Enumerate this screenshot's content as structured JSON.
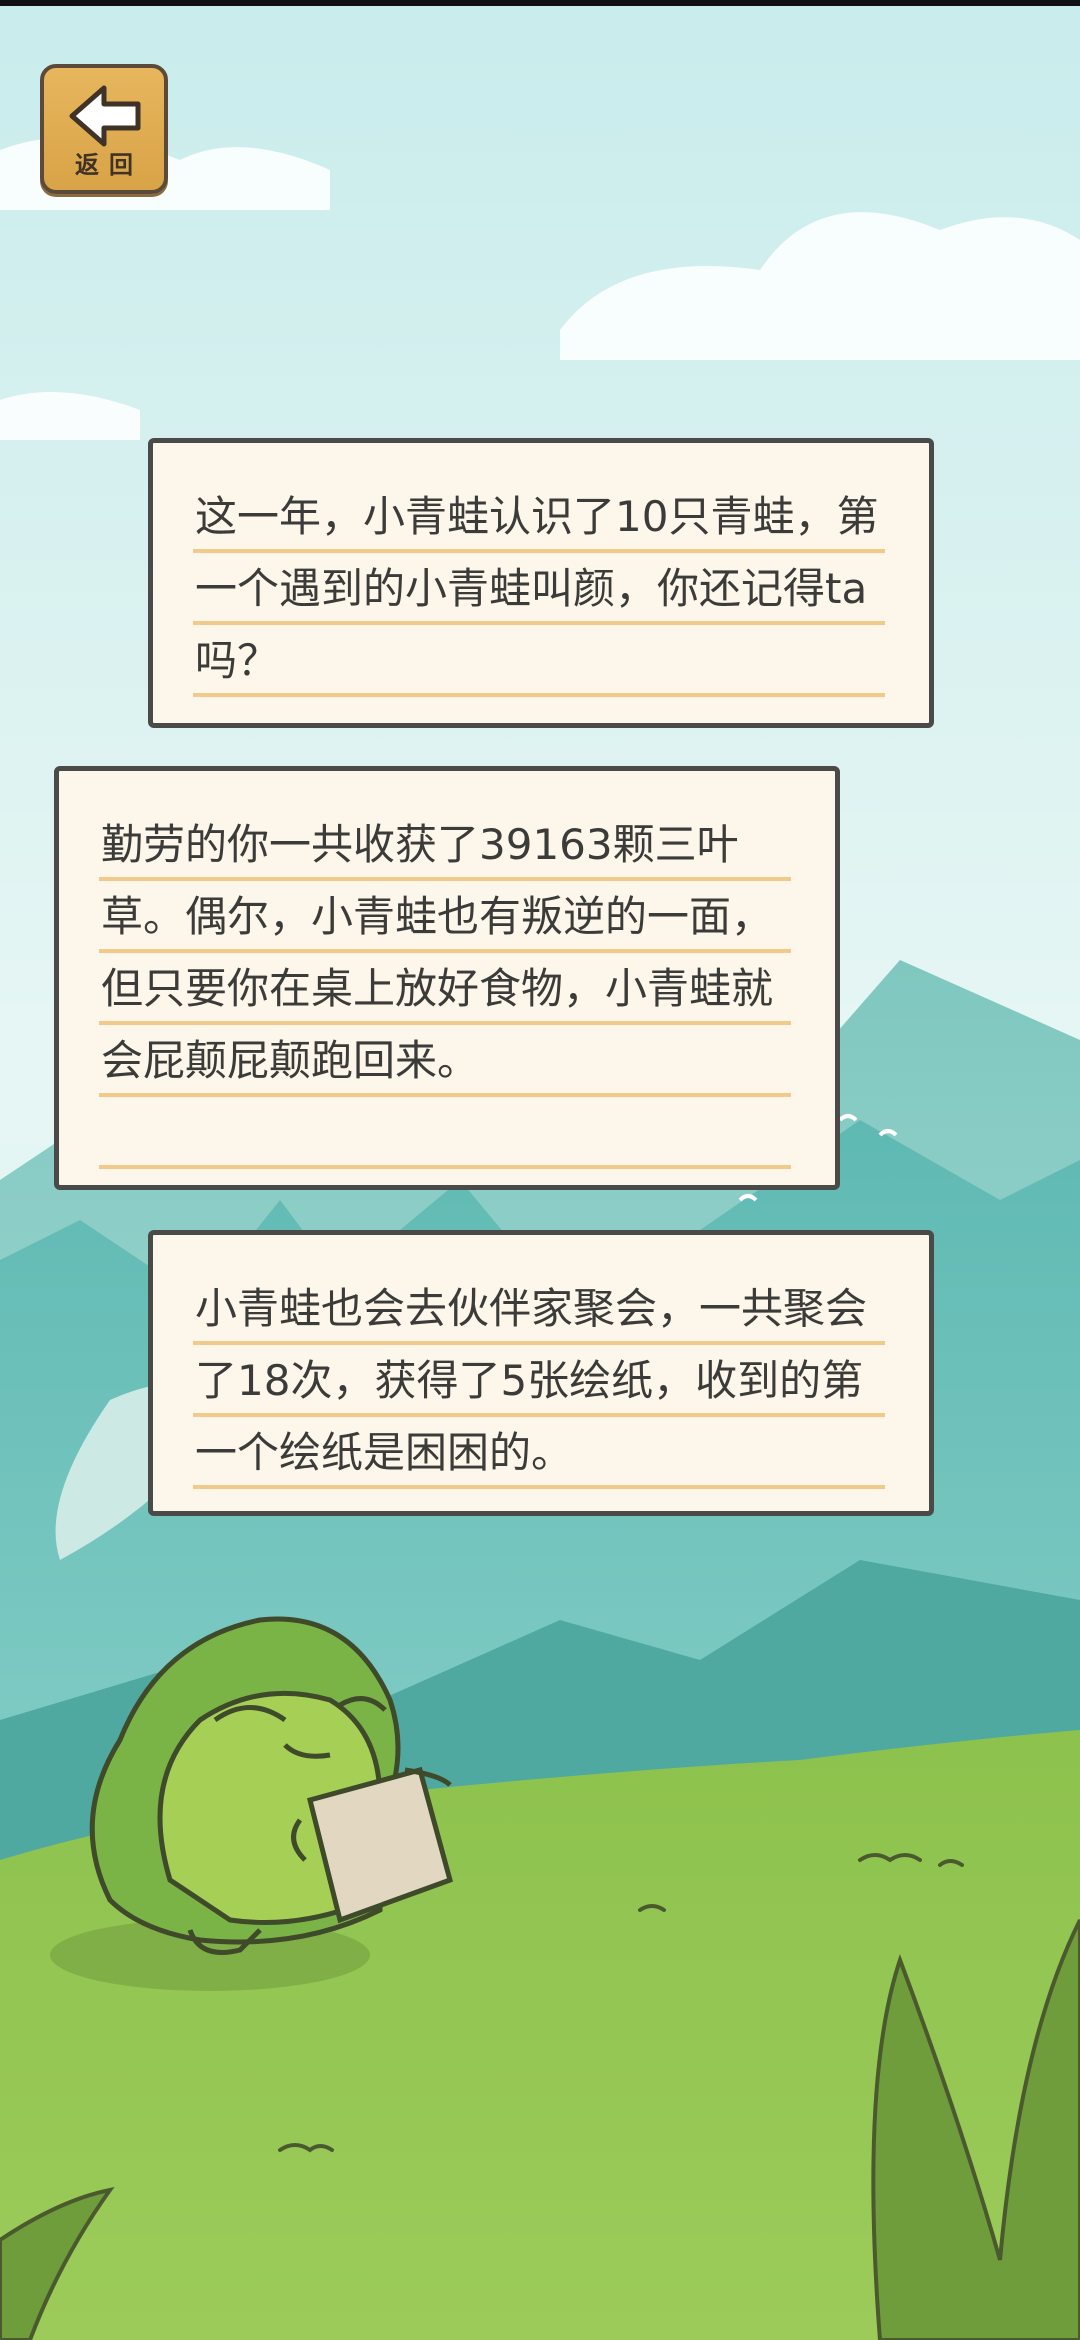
{
  "back_button": {
    "label": "返回",
    "icon": "back-arrow-icon"
  },
  "messages": [
    {
      "text": "这一年，小青蛙认识了10只青蛙，第一个遇到的小青蛙叫颜，你还记得ta吗？"
    },
    {
      "text": "勤劳的你一共收获了39163颗三叶草。偶尔，小青蛙也有叛逆的一面，但只要你在桌上放好食物，小青蛙就会屁颠屁颠跑回来。"
    },
    {
      "text": "小青蛙也会去伙伴家聚会，一共聚会了18次，获得了5张绘纸，收到的第一个绘纸是困困的。"
    }
  ],
  "colors": {
    "sky": "#d9f2f0",
    "grass": "#8cbf4a",
    "bubble_fill": "#fdf6ea",
    "bubble_border": "#4a4a48",
    "underline": "#f2c98a",
    "button_wood": "#dcaa4f"
  }
}
